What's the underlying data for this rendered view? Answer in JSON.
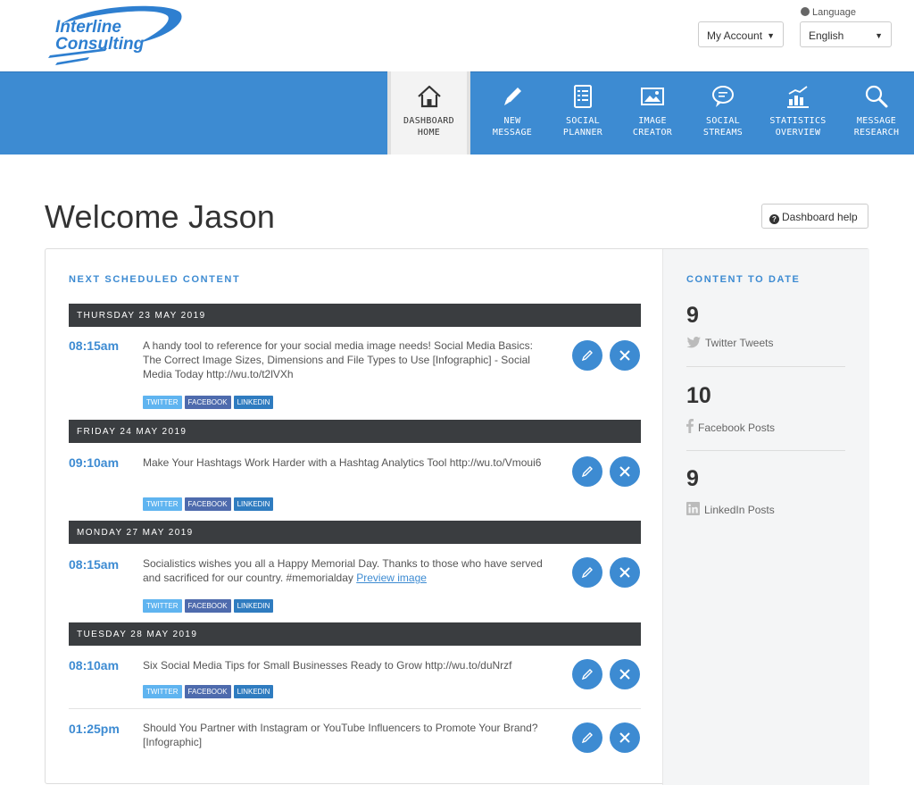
{
  "brand": {
    "name_line1": "Interline",
    "name_line2": "Consulting"
  },
  "header": {
    "language_label": "Language",
    "account_select": "My Account",
    "language_select": "English"
  },
  "nav": [
    {
      "label1": "DASHBOARD",
      "label2": "HOME",
      "icon": "home-icon"
    },
    {
      "label1": "NEW",
      "label2": "MESSAGE",
      "icon": "pencil-icon"
    },
    {
      "label1": "SOCIAL",
      "label2": "PLANNER",
      "icon": "planner-icon"
    },
    {
      "label1": "IMAGE",
      "label2": "CREATOR",
      "icon": "image-icon"
    },
    {
      "label1": "SOCIAL",
      "label2": "STREAMS",
      "icon": "chat-bubble-icon"
    },
    {
      "label1": "STATISTICS",
      "label2": "OVERVIEW",
      "icon": "chart-icon"
    },
    {
      "label1": "MESSAGE",
      "label2": "RESEARCH",
      "icon": "magnifier-icon"
    }
  ],
  "welcome": "Welcome Jason",
  "help_button": "Dashboard help",
  "scheduled": {
    "title": "NEXT SCHEDULED CONTENT",
    "days": [
      {
        "date": "THURSDAY 23 MAY 2019",
        "items": [
          {
            "time": "08:15am",
            "text": "A handy tool to reference for your social media image needs! Social Media Basics: The Correct Image Sizes, Dimensions and File Types to Use [Infographic] - Social Media Today http://wu.to/t2lVXh",
            "link": ""
          }
        ]
      },
      {
        "date": "FRIDAY 24 MAY 2019",
        "items": [
          {
            "time": "09:10am",
            "text": "Make Your Hashtags Work Harder with a Hashtag Analytics Tool http://wu.to/Vmoui6",
            "link": ""
          }
        ]
      },
      {
        "date": "MONDAY 27 MAY 2019",
        "items": [
          {
            "time": "08:15am",
            "text": "Socialistics wishes you all a Happy Memorial Day. Thanks to those who have served and sacrificed for our country. #memorialday",
            "link": "Preview image"
          }
        ]
      },
      {
        "date": "TUESDAY 28 MAY 2019",
        "items": [
          {
            "time": "08:10am",
            "text": "Six Social Media Tips for Small Businesses Ready to Grow http://wu.to/duNrzf",
            "link": ""
          },
          {
            "time": "01:25pm",
            "text": "Should You Partner with Instagram or YouTube Influencers to Promote Your Brand? [Infographic]",
            "link": ""
          }
        ]
      }
    ],
    "tags": {
      "twitter": "TWITTER",
      "facebook": "FACEBOOK",
      "linkedin": "LINKEDIN"
    }
  },
  "content_to_date": {
    "title": "CONTENT TO DATE",
    "stats": [
      {
        "count": "9",
        "label": "Twitter Tweets",
        "icon": "twitter-icon"
      },
      {
        "count": "10",
        "label": "Facebook Posts",
        "icon": "facebook-icon"
      },
      {
        "count": "9",
        "label": "LinkedIn Posts",
        "icon": "linkedin-icon"
      }
    ]
  },
  "colors": {
    "accent": "#3d8bd2",
    "day_bar": "#3a3d40",
    "twitter": "#5fb4f0",
    "facebook": "#4e6bad",
    "linkedin": "#2f7cc0"
  }
}
